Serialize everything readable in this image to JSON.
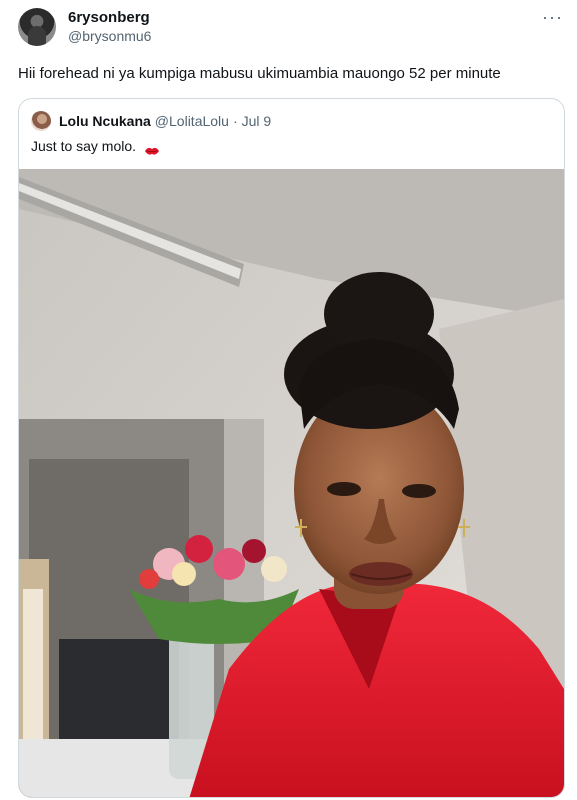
{
  "tweet": {
    "author": {
      "display_name": "6rysonberg",
      "handle": "@brysonmu6",
      "avatar_icon": "avatar-photo"
    },
    "more_label": "···",
    "text": "Hii forehead ni ya kumpiga mabusu ukimuambia mauongo 52 per minute"
  },
  "quote": {
    "author": {
      "display_name": "Lolu Ncukana",
      "handle": "@LolitaLolu",
      "separator": "·",
      "date": "Jul 9"
    },
    "text": "Just to say molo.",
    "emoji_icon": "kiss-mark-icon",
    "media_kind": "selfie-photo"
  },
  "colors": {
    "text_primary": "#0f1419",
    "text_secondary": "#536471",
    "border": "#cfd9de",
    "shirt_red": "#e0162b"
  }
}
